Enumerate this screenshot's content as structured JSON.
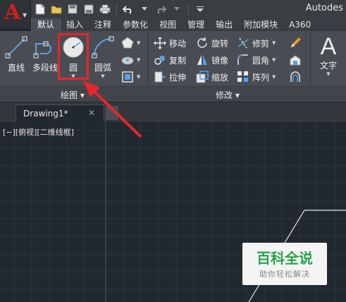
{
  "app": {
    "logo_letter": "A",
    "title": "Autodes"
  },
  "tabs": [
    "默认",
    "插入",
    "注释",
    "参数化",
    "视图",
    "管理",
    "输出",
    "附加模块",
    "A360"
  ],
  "ribbon": {
    "draw_tools": {
      "line": "直线",
      "polyline": "多段线",
      "circle": "圆",
      "arc": "圆弧"
    },
    "modify_tools": {
      "move": "移动",
      "rotate": "旋转",
      "trim": "修剪",
      "copy": "复制",
      "mirror": "镜像",
      "fillet": "圆角",
      "stretch": "拉伸",
      "scale": "缩放",
      "array": "阵列"
    },
    "text_tool": {
      "glyph": "A",
      "label": "文字"
    },
    "panel_titles": {
      "draw": "绘图 ▾",
      "modify": "修改 ▾"
    }
  },
  "document": {
    "tab_label": "Drawing1*",
    "close_glyph": "✕"
  },
  "viewport": {
    "view_label": "[−][俯视][二维线框]"
  },
  "watermark": {
    "main": "百科全说",
    "sub": "助你轻松解决"
  },
  "colors": {
    "highlight": "#e8242c",
    "canvas_bg": "#212830",
    "grid_line": "#2c3440",
    "y_axis": "#2c6e38",
    "watermark_green": "#2aa34a"
  }
}
